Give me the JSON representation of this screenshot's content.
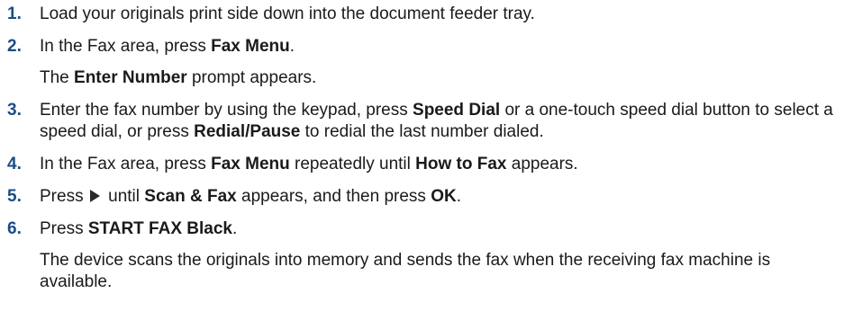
{
  "steps": [
    {
      "number": "1.",
      "parts": [
        "Load your originals print side down into the document feeder tray."
      ]
    },
    {
      "number": "2.",
      "parts": [
        "In the Fax area, press ",
        "Fax Menu",
        "."
      ],
      "note": [
        "The ",
        "Enter Number",
        " prompt appears."
      ]
    },
    {
      "number": "3.",
      "parts": [
        "Enter the fax number by using the keypad, press ",
        "Speed Dial",
        " or a one-touch speed dial button to select a speed dial, or press ",
        "Redial/Pause",
        " to redial the last number dialed."
      ]
    },
    {
      "number": "4.",
      "parts": [
        "In the Fax area, press ",
        "Fax Menu",
        " repeatedly until ",
        "How to Fax",
        " appears."
      ]
    },
    {
      "number": "5.",
      "parts": [
        "Press ",
        " until ",
        "Scan & Fax",
        " appears, and then press ",
        "OK",
        "."
      ],
      "icon": "right-arrow-icon"
    },
    {
      "number": "6.",
      "parts": [
        "Press ",
        "START FAX Black",
        "."
      ],
      "note": [
        "The device scans the originals into memory and sends the fax when the receiving fax machine is available."
      ]
    }
  ]
}
